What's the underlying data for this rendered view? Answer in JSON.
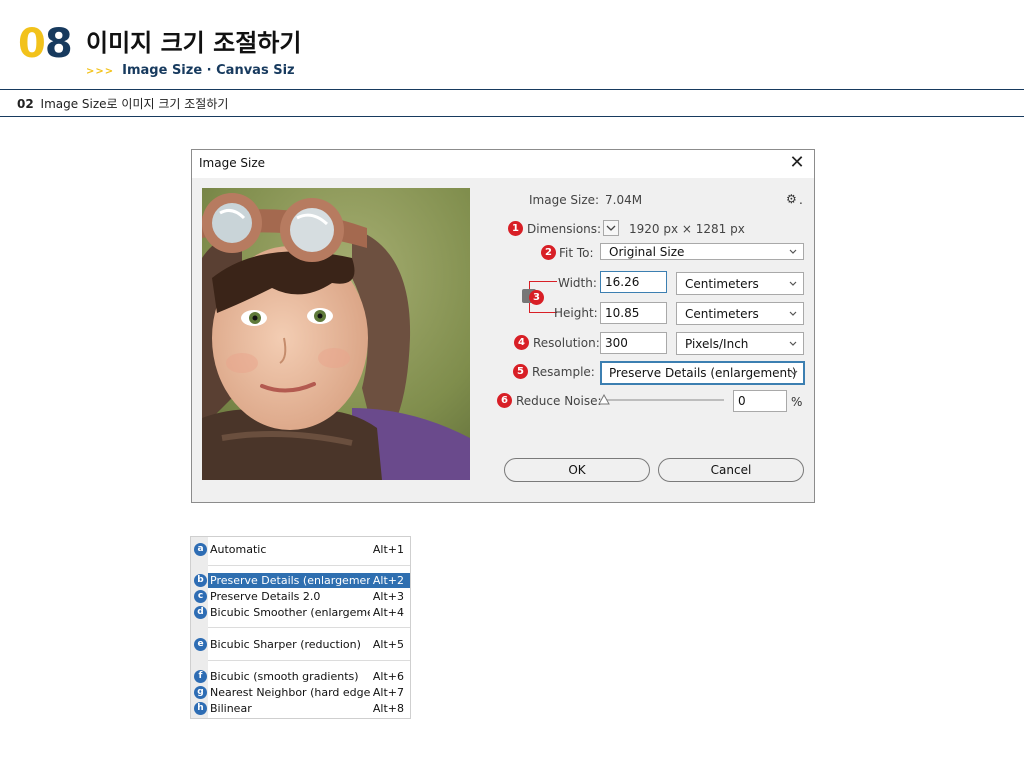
{
  "header": {
    "num_first": "0",
    "num_second": "8",
    "title": "이미지 크기 조절하기",
    "sub_arrows": ">>>",
    "subtitle": "Image Size · Canvas Siz",
    "section_num": "02",
    "section_text": "Image Size로 이미지 크기 조절하기"
  },
  "dialog": {
    "title": "Image Size",
    "close": "✕",
    "image_size_label": "Image Size:",
    "image_size_value": "7.04M",
    "gear": "⚙",
    "dimensions_label": "Dimensions:",
    "dimensions_value": "1920 px  ×  1281 px",
    "fit_to_label": "Fit To:",
    "fit_to_value": "Original Size",
    "width_label": "Width:",
    "width_value": "16.26",
    "width_unit": "Centimeters",
    "height_label": "Height:",
    "height_value": "10.85",
    "height_unit": "Centimeters",
    "resolution_label": "Resolution:",
    "resolution_value": "300",
    "resolution_unit": "Pixels/Inch",
    "resample_label": "Resample:",
    "resample_value": "Preserve Details (enlargement)",
    "reduce_noise_label": "Reduce Noise:",
    "reduce_noise_value": "0",
    "reduce_noise_unit": "%",
    "ok": "OK",
    "cancel": "Cancel",
    "badges": [
      "1",
      "2",
      "3",
      "4",
      "5",
      "6"
    ]
  },
  "menu": {
    "items": [
      {
        "badge": "a",
        "label": "Automatic",
        "key": "Alt+1"
      },
      {
        "badge": "b",
        "label": "Preserve Details (enlargement)",
        "key": "Alt+2"
      },
      {
        "badge": "c",
        "label": "Preserve Details 2.0",
        "key": "Alt+3"
      },
      {
        "badge": "d",
        "label": "Bicubic Smoother (enlargeme...",
        "key": "Alt+4"
      },
      {
        "badge": "e",
        "label": "Bicubic Sharper (reduction)",
        "key": "Alt+5"
      },
      {
        "badge": "f",
        "label": "Bicubic (smooth gradients)",
        "key": "Alt+6"
      },
      {
        "badge": "g",
        "label": "Nearest Neighbor (hard edges)",
        "key": "Alt+7"
      },
      {
        "badge": "h",
        "label": "Bilinear",
        "key": "Alt+8"
      }
    ],
    "selected_index": 1
  },
  "colors": {
    "accent_yellow": "#f2c21b",
    "navy": "#173a5e",
    "badge_red": "#d81f26",
    "badge_blue": "#2e6db4",
    "menu_selected": "#2f6fb0"
  }
}
